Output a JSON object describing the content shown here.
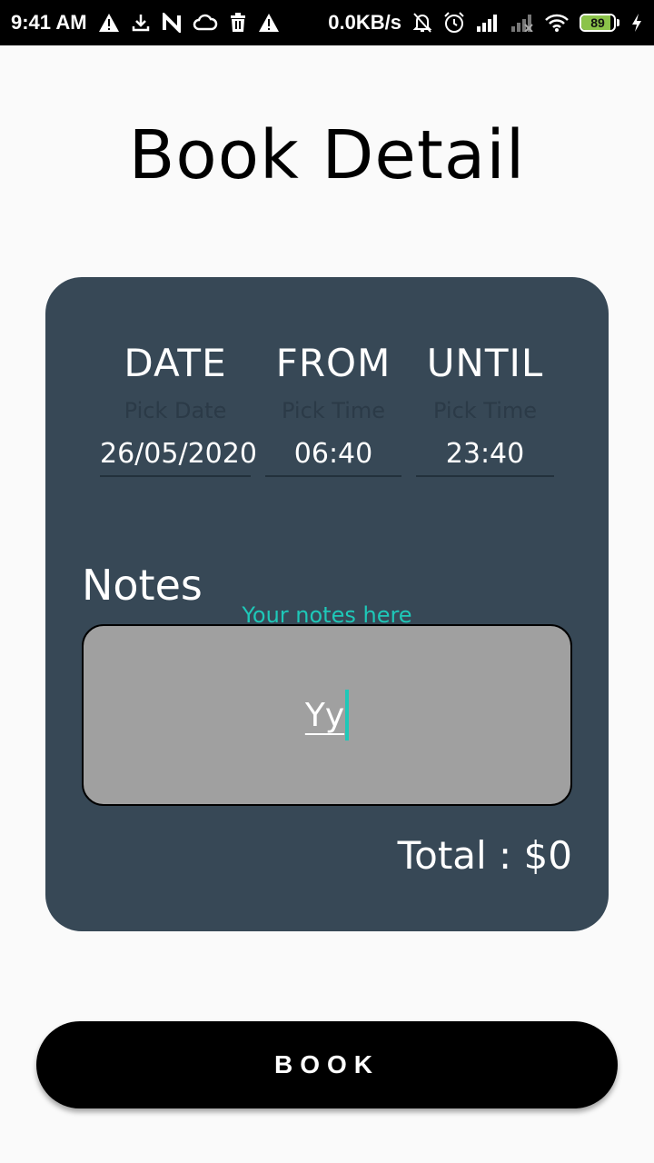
{
  "status_bar": {
    "time": "9:41 AM",
    "network_speed": "0.0KB/s",
    "battery_level": "89",
    "battery_fraction": 0.89,
    "left_icons": [
      "warning-icon",
      "download-icon",
      "n-app-icon",
      "cloud-icon",
      "trash-icon",
      "warning-icon"
    ],
    "right_icons": [
      "bell-off-icon",
      "alarm-icon",
      "signal-icon",
      "signal-off-icon",
      "wifi-icon",
      "battery-icon",
      "charging-icon"
    ]
  },
  "page": {
    "title": "Book Detail"
  },
  "form": {
    "date": {
      "label": "DATE",
      "hint": "Pick Date",
      "value": "26/05/2020"
    },
    "from": {
      "label": "FROM",
      "hint": "Pick Time",
      "value": "06:40"
    },
    "until": {
      "label": "UNTIL",
      "hint": "Pick Time",
      "value": "23:40"
    },
    "notes": {
      "label": "Notes",
      "hint": "Your notes here",
      "value": "Yy"
    },
    "total": "Total : $0"
  },
  "actions": {
    "book_label": "BOOK"
  },
  "colors": {
    "card": "#374856",
    "accent": "#1ec8b8",
    "notes_box": "#a0a0a0",
    "button": "#000000"
  }
}
